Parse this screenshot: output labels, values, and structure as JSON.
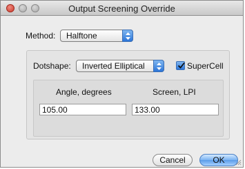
{
  "window": {
    "title": "Output Screening Override"
  },
  "method": {
    "label": "Method:",
    "value": "Halftone"
  },
  "dotshape": {
    "label": "Dotshape:",
    "value": "Inverted Elliptical"
  },
  "supercell": {
    "label": "SuperCell",
    "checked": true
  },
  "angle": {
    "label": "Angle, degrees",
    "value": "105.00"
  },
  "screen": {
    "label": "Screen, LPI",
    "value": "133.00"
  },
  "buttons": {
    "cancel": "Cancel",
    "ok": "OK"
  },
  "icons": {
    "close": "close-icon",
    "minimize": "minimize-icon",
    "zoom": "zoom-icon",
    "popup_arrows": "updown-arrows-icon",
    "checkmark": "checkmark-icon",
    "resize": "resize-grip-icon"
  },
  "colors": {
    "accent": "#2c75d8",
    "window_bg": "#ececec",
    "close_red": "#c9392b"
  }
}
